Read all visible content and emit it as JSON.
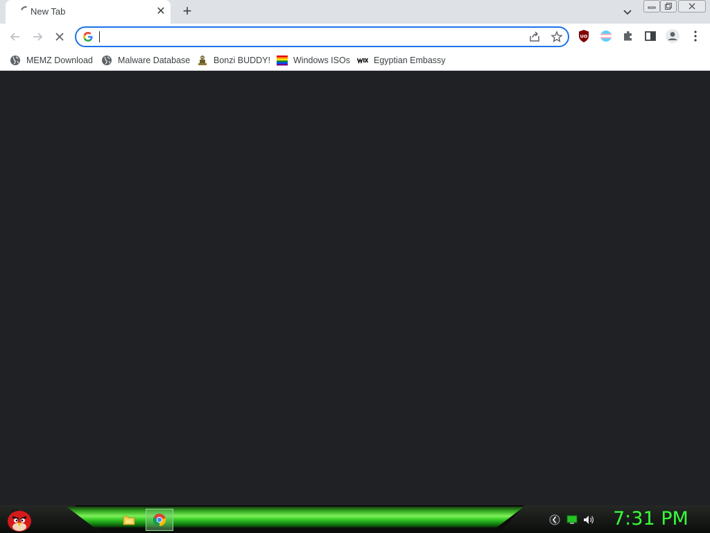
{
  "tabstrip": {
    "tabs": [
      {
        "title": "New Tab"
      }
    ]
  },
  "toolbar": {
    "omnibox_value": ""
  },
  "bookmarks": [
    {
      "label": "MEMZ Download",
      "icon": "globe-icon"
    },
    {
      "label": "Malware Database",
      "icon": "globe-icon"
    },
    {
      "label": "Bonzi BUDDY!",
      "icon": "bonzi-icon"
    },
    {
      "label": "Windows ISOs",
      "icon": "rainbow-flag-icon"
    },
    {
      "label": "Egyptian Embassy",
      "icon": "wix-icon"
    }
  ],
  "taskbar": {
    "clock": "7:31 PM",
    "items": [
      {
        "icon": "folder-icon",
        "active": false
      },
      {
        "icon": "chrome-icon",
        "active": true
      }
    ]
  },
  "colors": {
    "omnibox_focus": "#1a73e8",
    "content_bg": "#202124",
    "clock_text": "#39ff3a"
  }
}
